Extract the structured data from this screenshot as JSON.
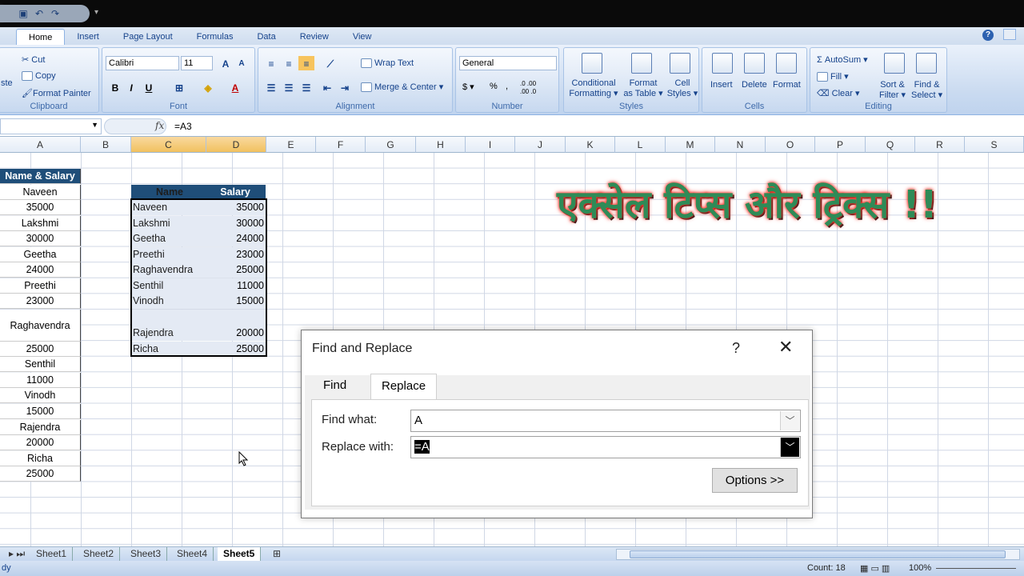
{
  "qat": {
    "save_icon": "save-icon",
    "undo_icon": "undo-icon",
    "redo_icon": "redo-icon",
    "more": "▾"
  },
  "tabs": [
    "Home",
    "Insert",
    "Page Layout",
    "Formulas",
    "Data",
    "Review",
    "View"
  ],
  "ribbon": {
    "clipboard": {
      "label": "Clipboard",
      "paste": "ste",
      "cut": "Cut",
      "copy": "Copy",
      "format_painter": "Format Painter"
    },
    "font": {
      "label": "Font",
      "family": "Calibri",
      "size": "11",
      "bold": "B",
      "italic": "I",
      "underline": "U",
      "grow": "A",
      "shrink": "A",
      "color": "A"
    },
    "alignment": {
      "label": "Alignment",
      "wrap": "Wrap Text",
      "merge": "Merge & Center ▾"
    },
    "number": {
      "label": "Number",
      "format": "General",
      "currency": "$ ▾",
      "percent": "%",
      "comma": ",",
      "dec_inc": ".0 .00",
      "dec_dec": ".00 .0"
    },
    "styles": {
      "label": "Styles",
      "cond1": "Conditional",
      "cond2": "Formatting ▾",
      "table1": "Format",
      "table2": "as Table ▾",
      "cell1": "Cell",
      "cell2": "Styles ▾"
    },
    "cells": {
      "label": "Cells",
      "insert": "Insert",
      "delete": "Delete",
      "format": "Format"
    },
    "editing": {
      "label": "Editing",
      "autosum": "Σ AutoSum ▾",
      "fill": "Fill ▾",
      "clear": "Clear ▾",
      "sort1": "Sort &",
      "sort2": "Filter ▾",
      "find1": "Find &",
      "find2": "Select ▾"
    }
  },
  "formula_bar": {
    "fx": "fx",
    "value": "=A3"
  },
  "columns": [
    "A",
    "B",
    "C",
    "D",
    "E",
    "F",
    "G",
    "H",
    "I",
    "J",
    "K",
    "L",
    "M",
    "N",
    "O",
    "P",
    "Q",
    "R",
    "S"
  ],
  "colA": [
    "Name & Salary",
    "Naveen",
    "35000",
    "Lakshmi",
    "30000",
    "Geetha",
    "24000",
    "Preethi",
    "23000",
    "Raghavendra",
    "25000",
    "Senthil",
    "11000",
    "Vinodh",
    "15000",
    "Rajendra",
    "20000",
    "Richa",
    "25000"
  ],
  "table": {
    "headers": [
      "Name",
      "Salary"
    ],
    "rows": [
      [
        "Naveen",
        "35000"
      ],
      [
        "Lakshmi",
        "30000"
      ],
      [
        "Geetha",
        "24000"
      ],
      [
        "Preethi",
        "23000"
      ],
      [
        "Raghavendra",
        "25000"
      ],
      [
        "Senthil",
        "11000"
      ],
      [
        "Vinodh",
        "15000"
      ],
      [
        "",
        ""
      ],
      [
        "Rajendra",
        "20000"
      ],
      [
        "Richa",
        "25000"
      ]
    ]
  },
  "banner": "एक्सेल टिप्स और ट्रिक्स !!",
  "dialog": {
    "title": "Find and Replace",
    "help": "?",
    "close": "✕",
    "tab_find": "Find",
    "tab_replace": "Replace",
    "find_label": "Find what:",
    "find_value": "A",
    "replace_label": "Replace with:",
    "replace_value": "=A",
    "options": "Options >>"
  },
  "sheets": [
    "Sheet1",
    "Sheet2",
    "Sheet3",
    "Sheet4",
    "Sheet5"
  ],
  "active_sheet": "Sheet5",
  "status": {
    "mode": "dy",
    "count": "Count: 18",
    "zoom": "100%"
  }
}
